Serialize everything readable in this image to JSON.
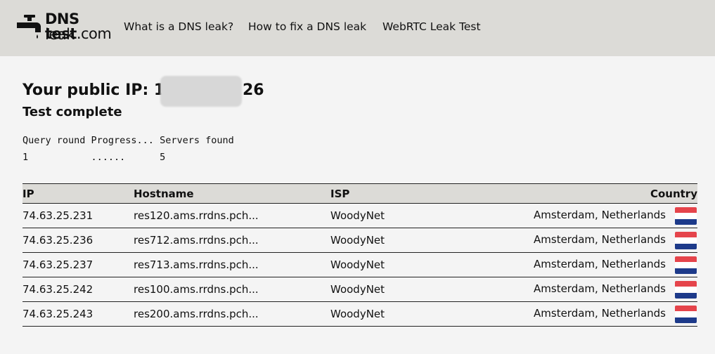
{
  "header": {
    "logo_line1_bold": "DNS",
    "logo_line1_thin": " leak",
    "logo_line2_bold": "test",
    "logo_line2_thin": ".com",
    "nav": [
      {
        "label": "What is a DNS leak?"
      },
      {
        "label": "How to fix a DNS leak"
      },
      {
        "label": "WebRTC Leak Test"
      }
    ]
  },
  "main": {
    "ip_prefix": "Your public IP: 14",
    "ip_suffix": "26",
    "status": "Test complete",
    "progress": {
      "header": "Query round Progress... Servers found",
      "values": "1           ......      5"
    }
  },
  "table": {
    "columns": [
      "IP",
      "Hostname",
      "ISP",
      "Country"
    ],
    "rows": [
      {
        "ip": "74.63.25.231",
        "hostname": "res120.ams.rrdns.pch...",
        "isp": "WoodyNet",
        "country": "Amsterdam, Netherlands"
      },
      {
        "ip": "74.63.25.236",
        "hostname": "res712.ams.rrdns.pch...",
        "isp": "WoodyNet",
        "country": "Amsterdam, Netherlands"
      },
      {
        "ip": "74.63.25.237",
        "hostname": "res713.ams.rrdns.pch...",
        "isp": "WoodyNet",
        "country": "Amsterdam, Netherlands"
      },
      {
        "ip": "74.63.25.242",
        "hostname": "res100.ams.rrdns.pch...",
        "isp": "WoodyNet",
        "country": "Amsterdam, Netherlands"
      },
      {
        "ip": "74.63.25.243",
        "hostname": "res200.ams.rrdns.pch...",
        "isp": "WoodyNet",
        "country": "Amsterdam, Netherlands"
      }
    ],
    "flag_icon": "netherlands-flag-icon",
    "flag_colors": [
      "#e5444b",
      "#ffffff",
      "#1d3a8a"
    ]
  }
}
